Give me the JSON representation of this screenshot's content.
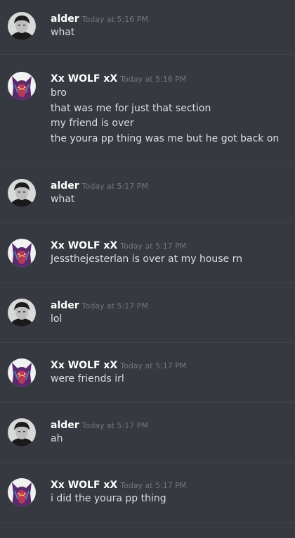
{
  "messages": [
    {
      "author": "alder",
      "timestamp": "Today at 5:16 PM",
      "lines": [
        "what"
      ]
    },
    {
      "author": "Xx WOLF xX",
      "timestamp": "Today at 5:16 PM",
      "lines": [
        "bro",
        "that was me for just that section",
        "my friend is over",
        "the youra pp thing was me but he got back on"
      ]
    },
    {
      "author": "alder",
      "timestamp": "Today at 5:17 PM",
      "lines": [
        "what"
      ]
    },
    {
      "author": "Xx WOLF xX",
      "timestamp": "Today at 5:17 PM",
      "lines": [
        "Jessthejesterlan is over at my house rn"
      ]
    },
    {
      "author": "alder",
      "timestamp": "Today at 5:17 PM",
      "lines": [
        "lol"
      ]
    },
    {
      "author": "Xx WOLF xX",
      "timestamp": "Today at 5:17 PM",
      "lines": [
        "were friends irl"
      ]
    },
    {
      "author": "alder",
      "timestamp": "Today at 5:17 PM",
      "lines": [
        "ah"
      ]
    },
    {
      "author": "Xx WOLF xX",
      "timestamp": "Today at 5:17 PM",
      "lines": [
        "i did the youra pp thing"
      ]
    }
  ],
  "avatars": {
    "alder": "portrait-avatar",
    "Xx WOLF xX": "wolf-avatar"
  },
  "colors": {
    "background": "#36393f",
    "username": "#ffffff",
    "timestamp": "#72767d",
    "message_text": "#dcddde"
  }
}
